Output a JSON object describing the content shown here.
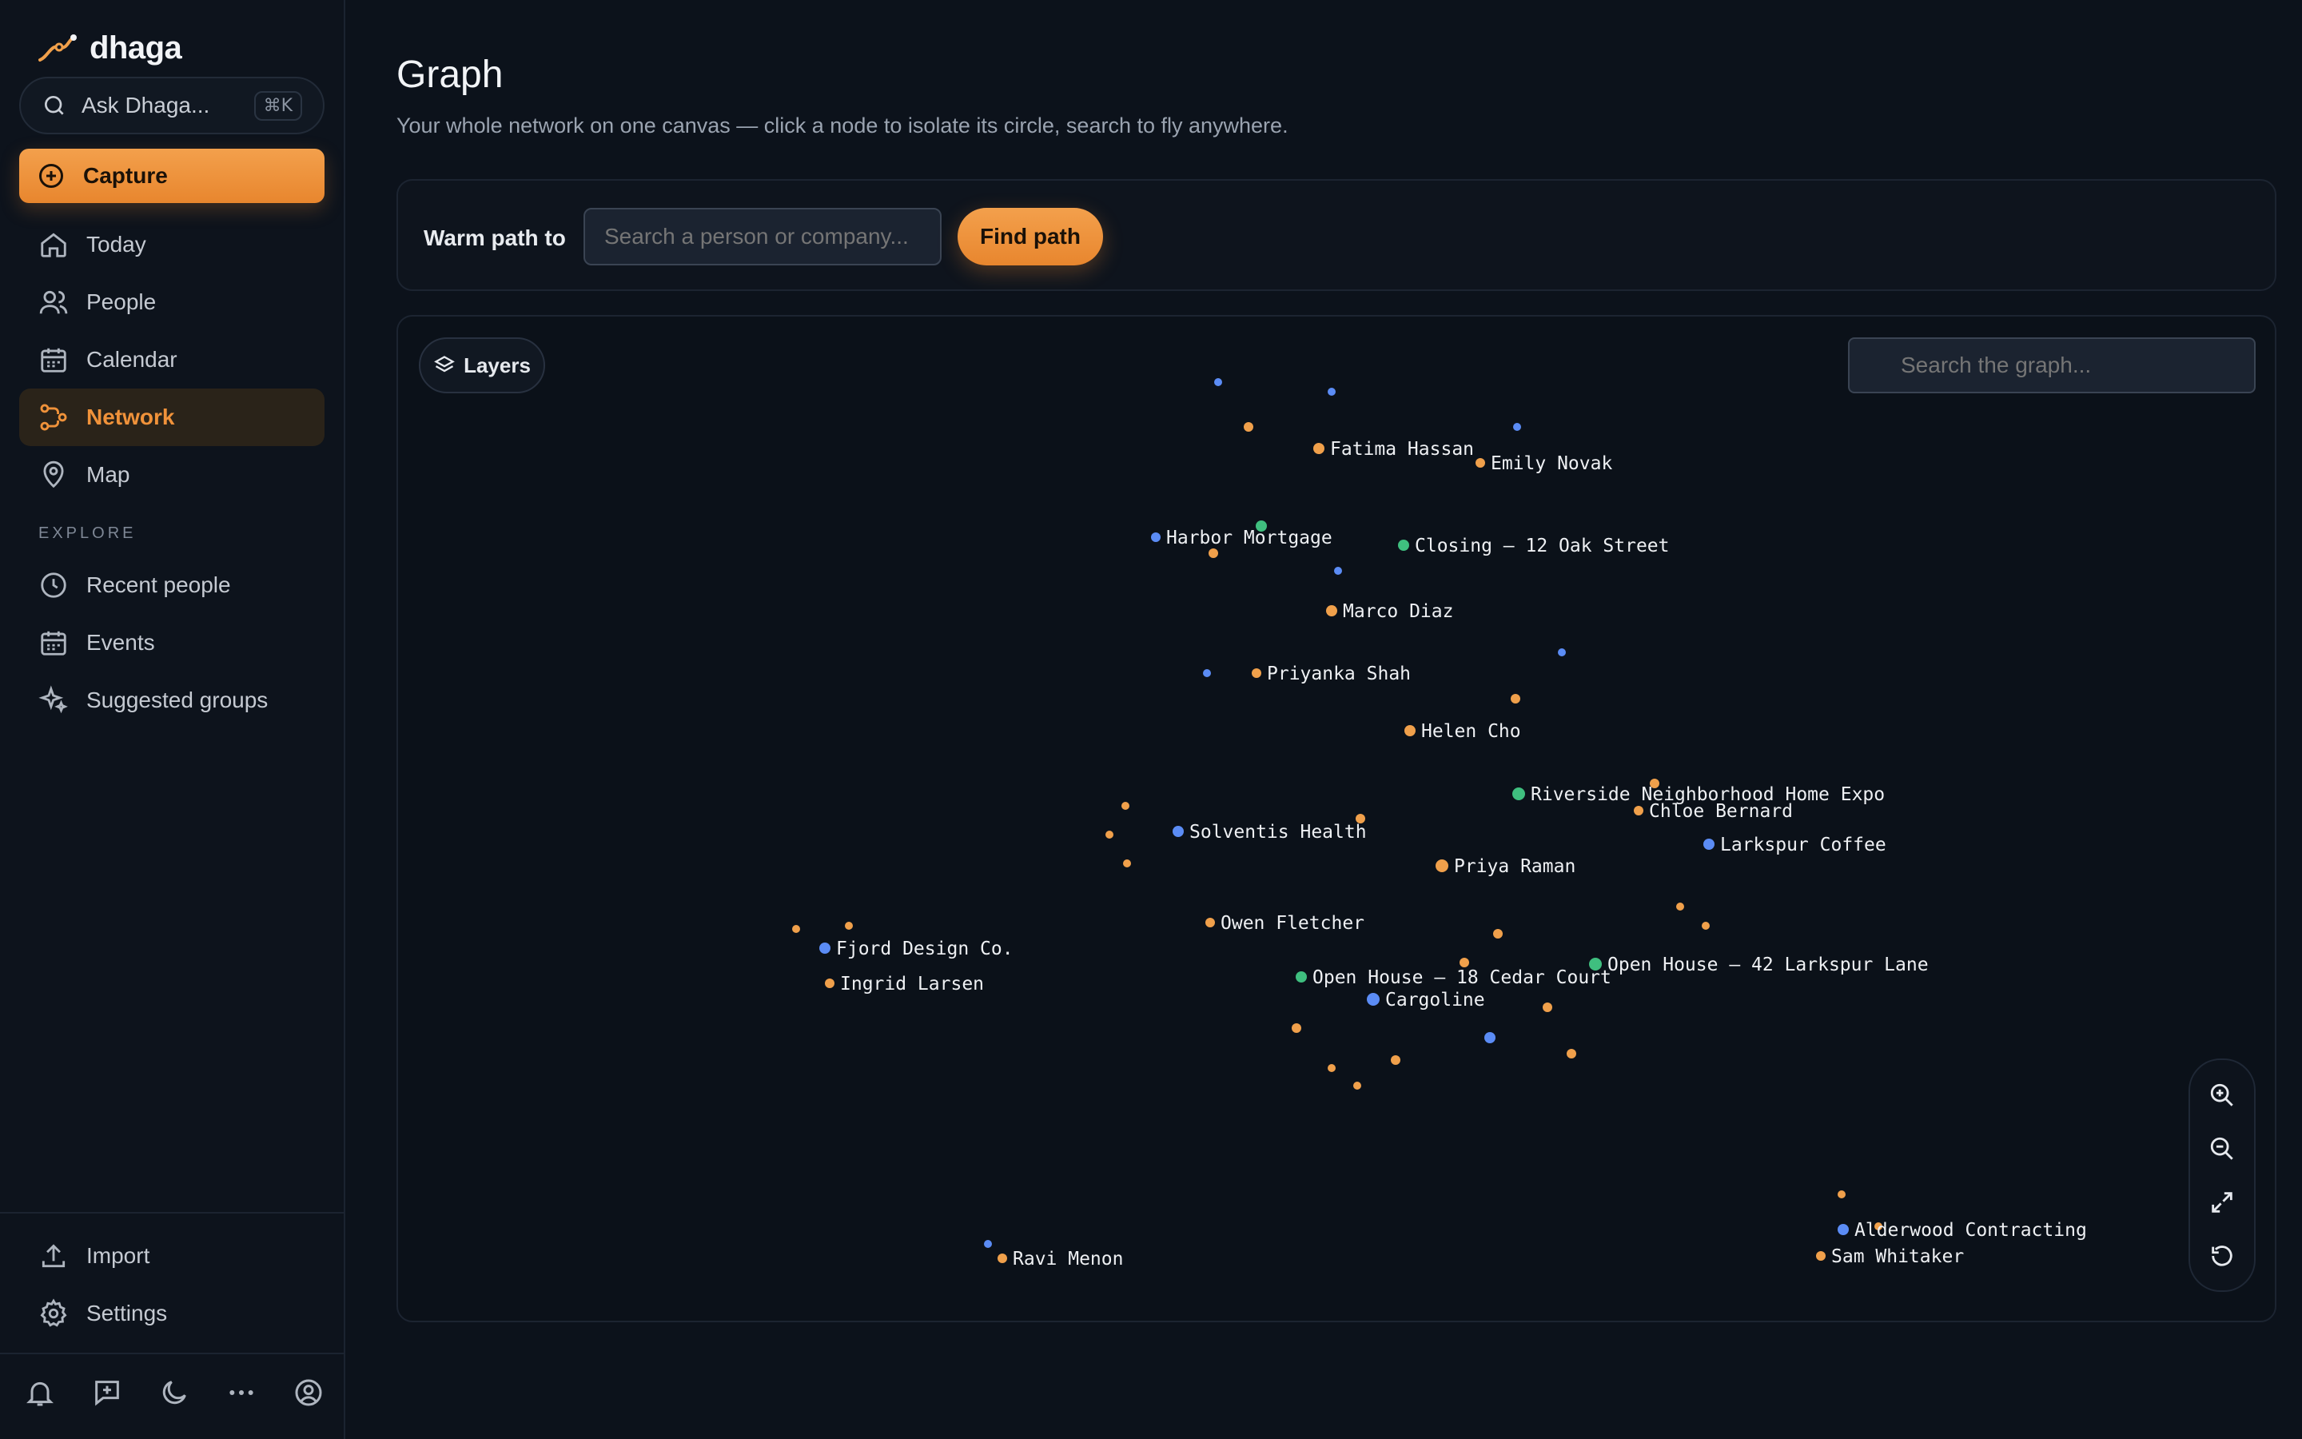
{
  "app": {
    "name": "dhaga"
  },
  "sidebar": {
    "ask": {
      "label": "Ask Dhaga...",
      "shortcut": "⌘K"
    },
    "capture_label": "Capture",
    "nav": [
      {
        "label": "Today",
        "icon": "home-icon"
      },
      {
        "label": "People",
        "icon": "users-icon"
      },
      {
        "label": "Calendar",
        "icon": "calendar-icon"
      },
      {
        "label": "Network",
        "icon": "network-icon",
        "active": true
      },
      {
        "label": "Map",
        "icon": "map-pin-icon"
      }
    ],
    "explore_label": "EXPLORE",
    "explore": [
      {
        "label": "Recent people",
        "icon": "clock-icon"
      },
      {
        "label": "Events",
        "icon": "calendar-icon"
      },
      {
        "label": "Suggested groups",
        "icon": "sparkles-icon"
      }
    ],
    "footer": [
      {
        "label": "Import",
        "icon": "upload-icon"
      },
      {
        "label": "Settings",
        "icon": "gear-icon"
      }
    ],
    "bottom_icons": [
      "bell-icon",
      "message-plus-icon",
      "moon-icon",
      "more-icon",
      "account-icon"
    ]
  },
  "page": {
    "title": "Graph",
    "subtitle": "Your whole network on one canvas — click a node to isolate its circle, search to fly anywhere."
  },
  "warm_path": {
    "label": "Warm path to",
    "placeholder": "Search a person or company...",
    "button": "Find path"
  },
  "graph": {
    "layers_label": "Layers",
    "search_placeholder": "Search the graph...",
    "colors": {
      "person": "#f0a04b",
      "company": "#5b8cf5",
      "event": "#3fbf7f"
    },
    "nodes": [
      {
        "label": "Fatima Hassan",
        "type": "person"
      },
      {
        "label": "Emily Novak",
        "type": "person"
      },
      {
        "label": "Harbor Mortgage",
        "type": "company"
      },
      {
        "label": "Closing — 12 Oak Street",
        "type": "event"
      },
      {
        "label": "Marco Diaz",
        "type": "person"
      },
      {
        "label": "Priyanka Shah",
        "type": "person"
      },
      {
        "label": "Helen Cho",
        "type": "person"
      },
      {
        "label": "Riverside Neighborhood Home Expo",
        "type": "event"
      },
      {
        "label": "Chloe Bernard",
        "type": "person"
      },
      {
        "label": "Solventis Health",
        "type": "company"
      },
      {
        "label": "Larkspur Coffee",
        "type": "company"
      },
      {
        "label": "Priya Raman",
        "type": "person"
      },
      {
        "label": "Owen Fletcher",
        "type": "person"
      },
      {
        "label": "Fjord Design Co.",
        "type": "company"
      },
      {
        "label": "Open House — 42 Larkspur Lane",
        "type": "event"
      },
      {
        "label": "Ingrid Larsen",
        "type": "person"
      },
      {
        "label": "Open House — 18 Cedar Court",
        "type": "event"
      },
      {
        "label": "Cargoline",
        "type": "company"
      },
      {
        "label": "Alderwood Contracting",
        "type": "company"
      },
      {
        "label": "Ravi Menon",
        "type": "person"
      },
      {
        "label": "Sam Whitaker",
        "type": "person"
      }
    ]
  }
}
